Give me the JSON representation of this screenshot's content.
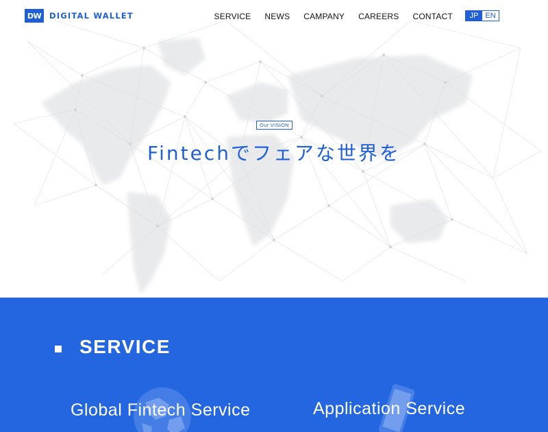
{
  "header": {
    "logo_mark": "DW",
    "logo_text": "DIGITAL WALLET",
    "nav": [
      "SERVICE",
      "NEWS",
      "CAMPANY",
      "CAREERS",
      "CONTACT"
    ],
    "lang": {
      "active": "JP",
      "inactive": "EN"
    }
  },
  "hero": {
    "badge": "Our VISION",
    "title": "Fintechでフェアな世界を"
  },
  "service": {
    "heading": "SERVICE",
    "cards": [
      "Global Fintech Service",
      "Application Service"
    ]
  },
  "colors": {
    "brand_blue": "#1e5fd8",
    "section_blue": "#2466e0"
  }
}
